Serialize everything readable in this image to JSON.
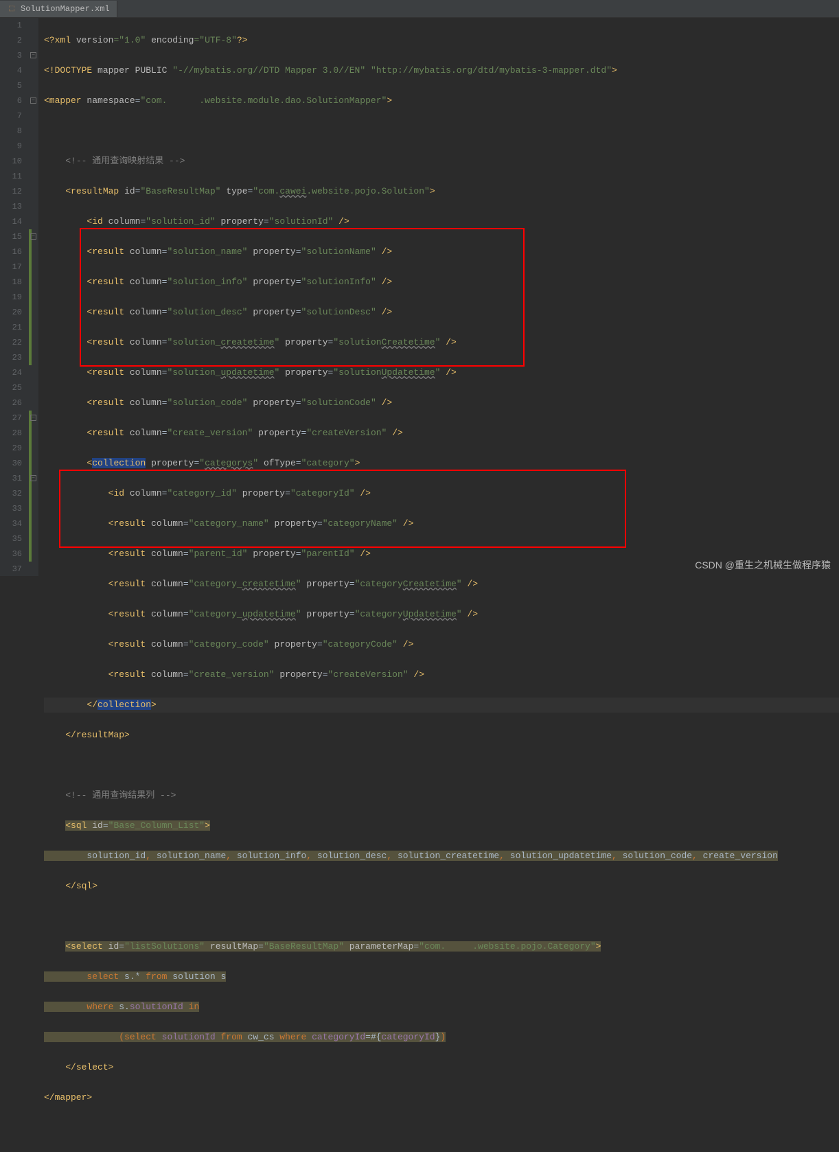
{
  "tab": {
    "filename": "SolutionMapper.xml",
    "icon": "xml-file-icon"
  },
  "watermark": "CSDN @重生之机械生做程序猿",
  "lines": {
    "l1": "<?xml version=\"1.0\" encoding=\"UTF-8\"?>",
    "l2": "<!DOCTYPE mapper PUBLIC \"-//mybatis.org//DTD Mapper 3.0//EN\" \"http://mybatis.org/dtd/mybatis-3-mapper.dtd\">",
    "l3": "<mapper namespace=\"com.      .website.module.dao.SolutionMapper\">",
    "l4": "",
    "l5": "    <!-- 通用查询映射结果 -->",
    "l6": "    <resultMap id=\"BaseResultMap\" type=\"com.cawei.website.pojo.Solution\">",
    "l7": "        <id column=\"solution_id\" property=\"solutionId\" />",
    "l8": "        <result column=\"solution_name\" property=\"solutionName\" />",
    "l9": "        <result column=\"solution_info\" property=\"solutionInfo\" />",
    "l10": "        <result column=\"solution_desc\" property=\"solutionDesc\" />",
    "l11": "        <result column=\"solution_createtime\" property=\"solutionCreatetime\" />",
    "l12": "        <result column=\"solution_updatetime\" property=\"solutionUpdatetime\" />",
    "l13": "        <result column=\"solution_code\" property=\"solutionCode\" />",
    "l14": "        <result column=\"create_version\" property=\"createVersion\" />",
    "l15": "        <collection property=\"categorys\" ofType=\"category\">",
    "l16": "            <id column=\"category_id\" property=\"categoryId\" />",
    "l17": "            <result column=\"category_name\" property=\"categoryName\" />",
    "l18": "            <result column=\"parent_id\" property=\"parentId\" />",
    "l19": "            <result column=\"category_createtime\" property=\"categoryCreatetime\" />",
    "l20": "            <result column=\"category_updatetime\" property=\"categoryUpdatetime\" />",
    "l21": "            <result column=\"category_code\" property=\"categoryCode\" />",
    "l22": "            <result column=\"create_version\" property=\"createVersion\" />",
    "l23": "        </collection>",
    "l24": "    </resultMap>",
    "l25": "",
    "l26": "    <!-- 通用查询结果列 -->",
    "l27": "    <sql id=\"Base_Column_List\">",
    "l28": "        solution_id, solution_name, solution_info, solution_desc, solution_createtime, solution_updatetime, solution_code, create_version",
    "l29": "    </sql>",
    "l30": "",
    "l31": "    <select id=\"listSolutions\" resultMap=\"BaseResultMap\" parameterMap=\"com.     .website.pojo.Category\">",
    "l32": "        select s.* from solution s",
    "l33": "        where s.solutionId in",
    "l34": "              (select solutionId from cw_cs where categoryId=#{categoryId})",
    "l35": "    </select>",
    "l36": "</mapper>",
    "l37": ""
  }
}
